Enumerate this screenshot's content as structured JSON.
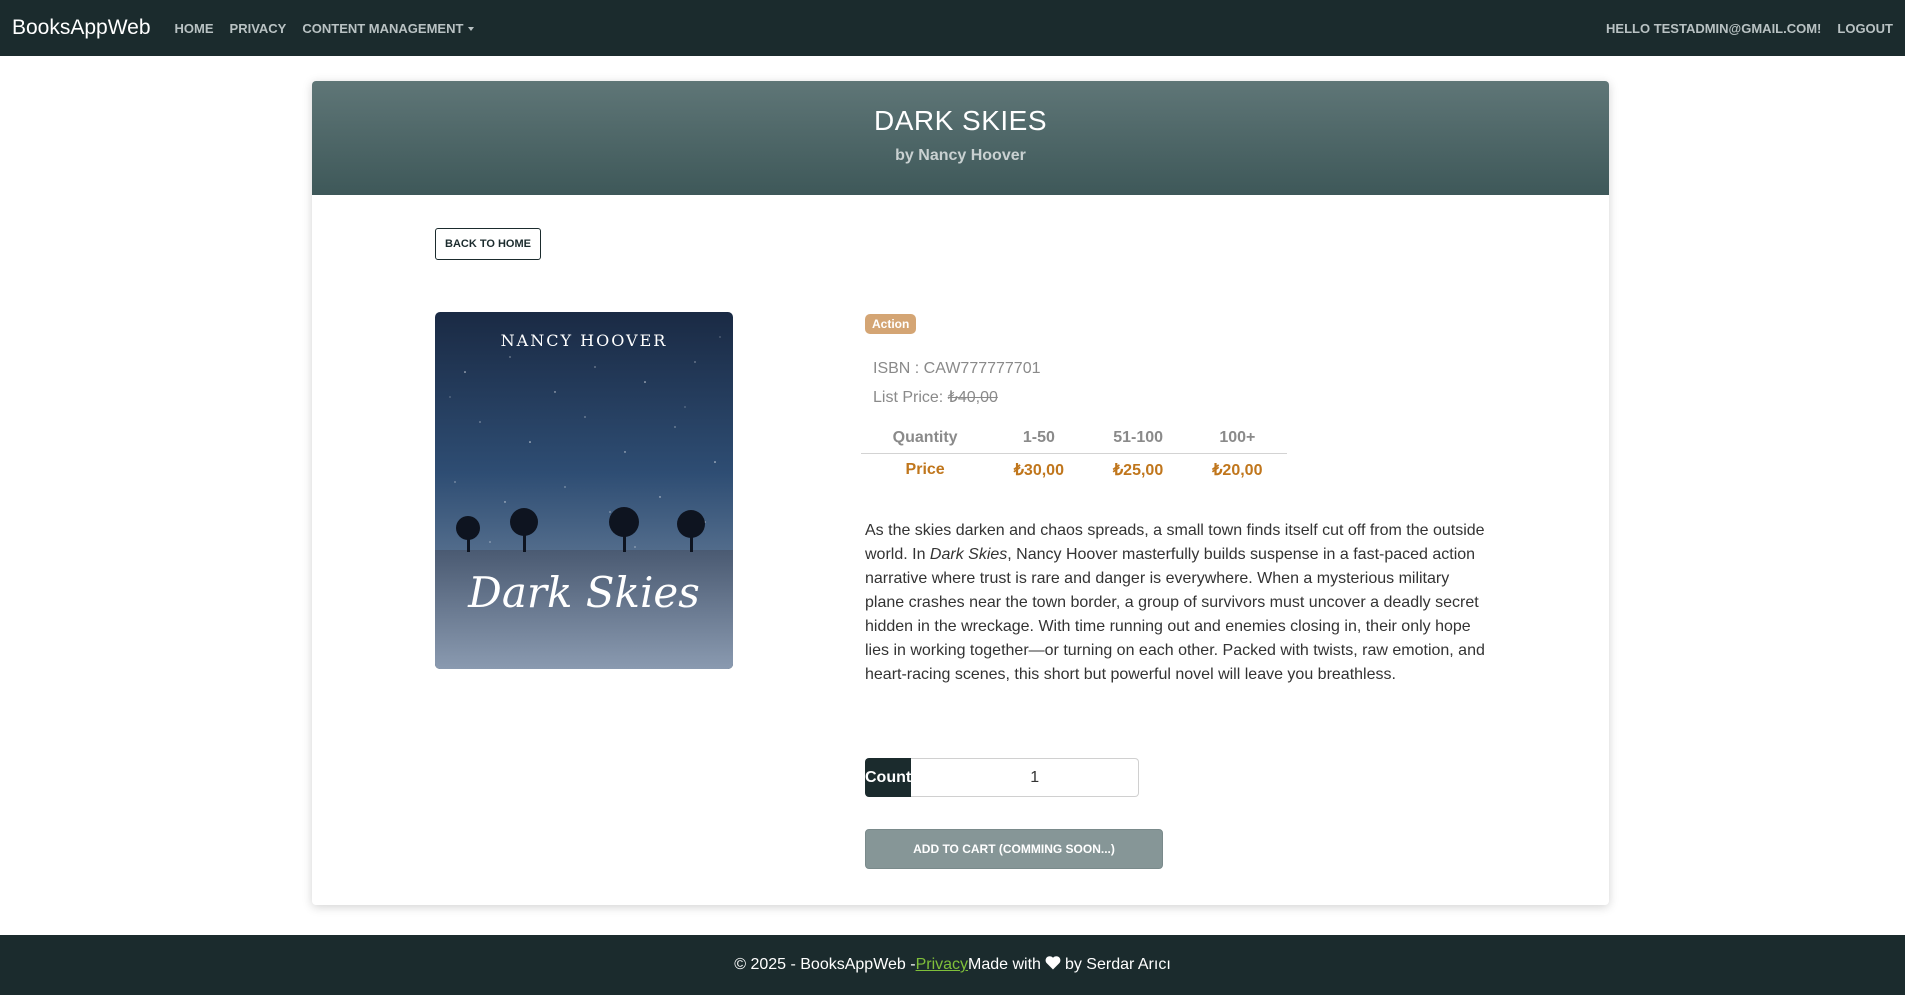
{
  "navbar": {
    "brand": "BooksAppWeb",
    "links": [
      {
        "label": "HOME"
      },
      {
        "label": "PRIVACY"
      },
      {
        "label": "CONTENT MANAGEMENT"
      }
    ],
    "greeting": "HELLO TESTADMIN@GMAIL.COM!",
    "logout": "LOGOUT"
  },
  "book": {
    "title": "DARK SKIES",
    "author_line": "by Nancy Hoover",
    "cover_author": "NANCY HOOVER",
    "cover_title": "Dark Skies",
    "category": "Action",
    "isbn": "ISBN : CAW777777701",
    "list_price_label": "List Price: ",
    "list_price": "₺40,00",
    "description_before": "As the skies darken and chaos spreads, a small town finds itself cut off from the outside world. In ",
    "description_italic": "Dark Skies",
    "description_after": ", Nancy Hoover masterfully builds suspense in a fast-paced action narrative where trust is rare and danger is everywhere. When a mysterious military plane crashes near the town border, a group of survivors must uncover a deadly secret hidden in the wreckage. With time running out and enemies closing in, their only hope lies in working together—or turning on each other. Packed with twists, raw emotion, and heart-racing scenes, this short but powerful novel will leave you breathless."
  },
  "pricing": {
    "quantity_header": "Quantity",
    "price_label": "Price",
    "tiers": [
      "1-50",
      "51-100",
      "100+"
    ],
    "prices": [
      "₺30,00",
      "₺25,00",
      "₺20,00"
    ]
  },
  "actions": {
    "back": "BACK TO HOME",
    "count_label": "Count",
    "count_value": "1",
    "add_to_cart": "ADD TO CART (COMMING SOON...)"
  },
  "footer": {
    "prefix": "© 2025 - BooksAppWeb - ",
    "privacy_link": "Privacy",
    "made_with": " Made with ",
    "suffix": " by Serdar Arıcı"
  },
  "colors": {
    "navbar": "#1b2b2d",
    "header_top": "#5f7677",
    "header_bottom": "#3e5859",
    "badge": "#d4a574",
    "price": "#c0761c",
    "cart_button": "#869697",
    "footer_link": "#7fbf3a"
  },
  "icons": {
    "dropdown": "caret-down-icon",
    "heart": "heart-icon"
  }
}
